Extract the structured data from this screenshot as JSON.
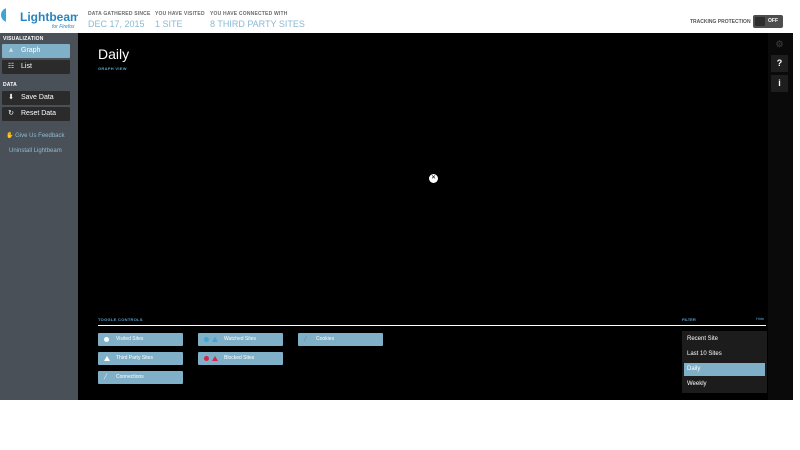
{
  "logo": {
    "name": "Lightbeam",
    "sub": "for Firefox"
  },
  "sidebar": {
    "visualization_heading": "VISUALIZATION",
    "visualization_items": [
      {
        "label": "Graph",
        "icon": "graph-icon",
        "active": true
      },
      {
        "label": "List",
        "icon": "list-icon",
        "active": false
      }
    ],
    "data_heading": "DATA",
    "data_items": [
      {
        "label": "Save Data",
        "icon": "save-icon"
      },
      {
        "label": "Reset Data",
        "icon": "reset-icon"
      }
    ],
    "feedback_label": "Give Us Feedback",
    "uninstall_label": "Uninstall Lightbeam"
  },
  "header": {
    "gathered_label": "DATA GATHERED SINCE",
    "gathered_value": "DEC 17, 2015",
    "visited_label": "YOU HAVE VISITED",
    "visited_value": "1 SITE",
    "connected_label": "YOU HAVE CONNECTED WITH",
    "connected_value": "8 THIRD PARTY SITES",
    "tracking_label": "TRACKING PROTECTION",
    "tracking_state": "OFF"
  },
  "main": {
    "title": "Daily",
    "subtitle": "GRAPH VIEW",
    "node_icon": "close-icon",
    "right_buttons": [
      {
        "icon": "settings-icon",
        "glyph": ""
      },
      {
        "icon": "help-icon",
        "glyph": "?"
      },
      {
        "icon": "info-icon",
        "glyph": "i"
      }
    ]
  },
  "controls": {
    "heading": "TOGGLE CONTROLS",
    "visited_sites": "Visited Sites",
    "watched_sites": "Watched Sites",
    "cookies": "Cookies",
    "third_party_sites": "Third Party Sites",
    "blocked_sites": "Blocked Sites",
    "connections": "Connections"
  },
  "filter": {
    "heading": "FILTER",
    "hide": "Hide",
    "options": [
      "Recent Site",
      "Last 10 Sites",
      "Daily",
      "Weekly"
    ],
    "selected": "Daily"
  },
  "colors": {
    "accent": "#7fb0c8",
    "link": "#5aa3d0",
    "sidebar_bg": "#495057",
    "canvas_bg": "#000000",
    "watched_blue": "#42a5d6",
    "blocked_red": "#d3264a"
  }
}
